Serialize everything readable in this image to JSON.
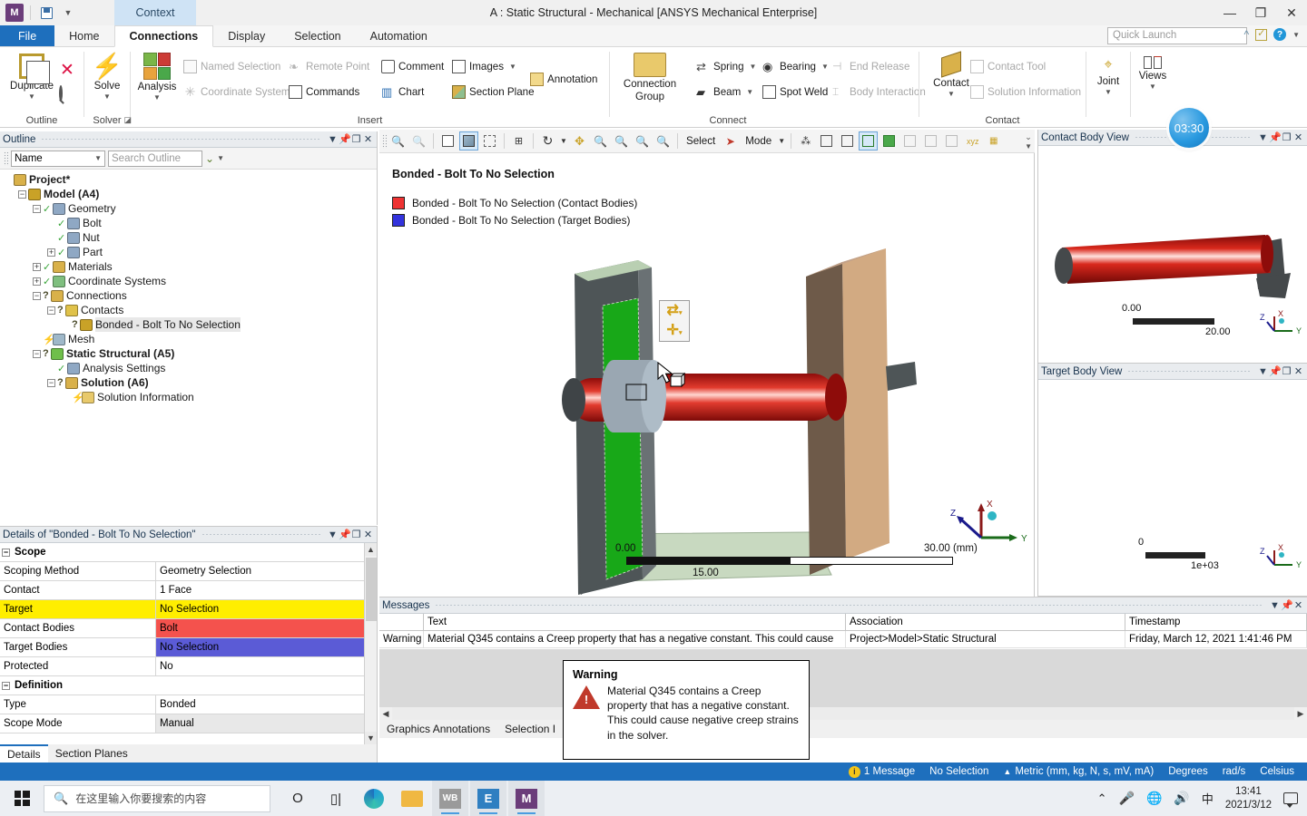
{
  "window": {
    "title": "A : Static Structural - Mechanical [ANSYS Mechanical Enterprise]",
    "app_icon_letter": "M",
    "context_tab": "Context",
    "minimize": "—",
    "restore": "❐",
    "close": "✕"
  },
  "ribbon": {
    "tabs": [
      {
        "label": "File",
        "kind": "file"
      },
      {
        "label": "Home",
        "kind": "normal"
      },
      {
        "label": "Connections",
        "kind": "active"
      },
      {
        "label": "Display",
        "kind": "normal"
      },
      {
        "label": "Selection",
        "kind": "normal"
      },
      {
        "label": "Automation",
        "kind": "normal"
      }
    ],
    "quick_launch_placeholder": "Quick Launch",
    "groups": [
      {
        "name": "Outline"
      },
      {
        "name": "Solver"
      },
      {
        "name": "Insert"
      },
      {
        "name": "Connect"
      },
      {
        "name": "Contact"
      }
    ],
    "outline_group": {
      "duplicate": "Duplicate",
      "delete_icon": "delete-x-icon",
      "find_icon": "magnifier-icon"
    },
    "solver_group": {
      "solve": "Solve"
    },
    "insert_group": {
      "analysis": "Analysis",
      "named_selection": "Named Selection",
      "coordinate_system": "Coordinate System",
      "remote_point": "Remote Point",
      "commands": "Commands",
      "comment": "Comment",
      "chart": "Chart",
      "images": "Images",
      "section_plane": "Section Plane",
      "annotation": "Annotation"
    },
    "connect_group": {
      "connection_group": "Connection\nGroup",
      "connection_group_l1": "Connection",
      "connection_group_l2": "Group",
      "spring": "Spring",
      "beam": "Beam",
      "bearing": "Bearing",
      "spot_weld": "Spot Weld",
      "end_release": "End Release",
      "body_interaction": "Body Interaction"
    },
    "contact_group": {
      "contact": "Contact",
      "contact_tool": "Contact Tool",
      "solution_information": "Solution Information",
      "joint": "Joint",
      "views": "Views"
    }
  },
  "outline": {
    "title": "Outline",
    "filter_selected": "Name",
    "search_placeholder": "Search Outline",
    "tree": [
      {
        "label": "Project*",
        "depth": 0,
        "exp": "none",
        "mark": "none",
        "icon": "project-icon",
        "bold": true,
        "selected": false
      },
      {
        "label": "Model (A4)",
        "depth": 1,
        "exp": "minus",
        "mark": "none",
        "icon": "model-icon",
        "bold": true,
        "selected": false
      },
      {
        "label": "Geometry",
        "depth": 2,
        "exp": "minus",
        "mark": "check",
        "icon": "geometry-icon",
        "bold": false,
        "selected": false
      },
      {
        "label": "Bolt",
        "depth": 3,
        "exp": "none",
        "mark": "check",
        "icon": "body-icon",
        "bold": false,
        "selected": false
      },
      {
        "label": "Nut",
        "depth": 3,
        "exp": "none",
        "mark": "check",
        "icon": "body-icon",
        "bold": false,
        "selected": false
      },
      {
        "label": "Part",
        "depth": 3,
        "exp": "plus",
        "mark": "check",
        "icon": "geometry-icon",
        "bold": false,
        "selected": false
      },
      {
        "label": "Materials",
        "depth": 2,
        "exp": "plus",
        "mark": "check",
        "icon": "materials-icon",
        "bold": false,
        "selected": false
      },
      {
        "label": "Coordinate Systems",
        "depth": 2,
        "exp": "plus",
        "mark": "check",
        "icon": "coordsys-icon",
        "bold": false,
        "selected": false
      },
      {
        "label": "Connections",
        "depth": 2,
        "exp": "minus",
        "mark": "question",
        "icon": "connections-icon",
        "bold": false,
        "selected": false
      },
      {
        "label": "Contacts",
        "depth": 3,
        "exp": "minus",
        "mark": "question",
        "icon": "contacts-icon",
        "bold": false,
        "selected": false
      },
      {
        "label": "Bonded - Bolt To No Selection",
        "depth": 4,
        "exp": "none",
        "mark": "question",
        "icon": "contact-region-icon",
        "bold": false,
        "selected": true
      },
      {
        "label": "Mesh",
        "depth": 2,
        "exp": "none",
        "mark": "light",
        "icon": "mesh-icon",
        "bold": false,
        "selected": false
      },
      {
        "label": "Static Structural (A5)",
        "depth": 2,
        "exp": "minus",
        "mark": "question",
        "icon": "static-structural-icon",
        "bold": true,
        "selected": false
      },
      {
        "label": "Analysis Settings",
        "depth": 3,
        "exp": "none",
        "mark": "check",
        "icon": "analysis-settings-icon",
        "bold": false,
        "selected": false
      },
      {
        "label": "Solution (A6)",
        "depth": 3,
        "exp": "minus",
        "mark": "question",
        "icon": "solution-icon",
        "bold": true,
        "selected": false
      },
      {
        "label": "Solution Information",
        "depth": 4,
        "exp": "none",
        "mark": "light",
        "icon": "solution-info-icon",
        "bold": false,
        "selected": false
      }
    ]
  },
  "details": {
    "title": "Details of \"Bonded - Bolt To No Selection\"",
    "rows": [
      {
        "type": "category",
        "key": "Scope",
        "value": "",
        "highlight": "none"
      },
      {
        "type": "field",
        "key": "Scoping Method",
        "value": "Geometry Selection",
        "highlight": "none"
      },
      {
        "type": "field",
        "key": "Contact",
        "value": "1 Face",
        "highlight": "none"
      },
      {
        "type": "field",
        "key": "Target",
        "value": "No Selection",
        "highlight": "yellow"
      },
      {
        "type": "field",
        "key": "Contact Bodies",
        "value": "Bolt",
        "highlight": "red"
      },
      {
        "type": "field",
        "key": "Target Bodies",
        "value": "No Selection",
        "highlight": "blue"
      },
      {
        "type": "field",
        "key": "Protected",
        "value": "No",
        "highlight": "none"
      },
      {
        "type": "category",
        "key": "Definition",
        "value": "",
        "highlight": "none"
      },
      {
        "type": "field",
        "key": "Type",
        "value": "Bonded",
        "highlight": "none"
      },
      {
        "type": "field",
        "key": "Scope Mode",
        "value": "Manual",
        "highlight": "gray"
      }
    ],
    "tabs": [
      {
        "label": "Details",
        "active": true
      },
      {
        "label": "Section Planes",
        "active": false
      }
    ],
    "highlight_colors": {
      "yellow": "#ffee00",
      "red": "#f4524d",
      "blue": "#5b5bd6",
      "gray": "#e8e8e8"
    }
  },
  "graphics_toolbar": {
    "select_label": "Select",
    "mode_label": "Mode",
    "buttons": [
      "zoom-out-icon",
      "zoom-in-icon",
      "wireframe-cube-icon",
      "shaded-cube-icon",
      "edges-cube-icon",
      "box-select-icon",
      "rotate-icon",
      "pan-icon",
      "zoom-minus-icon",
      "zoom-plus-icon",
      "box-zoom-icon",
      "zoom-to-fit-icon",
      "select-arrow-icon",
      "extend-selection-icon",
      "vertex-select-icon",
      "edge-select-icon",
      "face-select-icon",
      "body-select-icon",
      "single-select-icon",
      "box-volume-select-icon",
      "box-surface-select-icon",
      "xyz-probe-icon",
      "label-icon"
    ]
  },
  "viewport": {
    "title": "Bonded - Bolt To No Selection",
    "legend": [
      {
        "color": "#ee3333",
        "label": "Bonded - Bolt To No Selection (Contact Bodies)"
      },
      {
        "color": "#3333dd",
        "label": "Bonded - Bolt To No Selection (Target Bodies)"
      }
    ],
    "scale": {
      "min": "0.00",
      "mid": "15.00",
      "max": "30.00 (mm)"
    },
    "triad": {
      "x": "X",
      "y": "Y",
      "z": "Z"
    }
  },
  "contact_body_view": {
    "title": "Contact Body View",
    "scale": {
      "min": "0.00",
      "max": "20.00"
    },
    "triad": {
      "x": "X",
      "y": "Y",
      "z": "Z"
    }
  },
  "target_body_view": {
    "title": "Target Body View",
    "scale": {
      "min": "0",
      "max": "1e+03"
    },
    "triad": {
      "x": "X",
      "y": "Y",
      "z": "Z"
    }
  },
  "messages": {
    "title": "Messages",
    "columns": [
      "",
      "Text",
      "Association",
      "Timestamp"
    ],
    "rows": [
      {
        "type": "Warning",
        "text": "Material Q345 contains a Creep property that has a negative constant. This could cause",
        "association": "Project>Model>Static Structural",
        "timestamp": "Friday, March 12, 2021 1:41:46 PM"
      }
    ],
    "tabs": [
      {
        "label": "Graphics Annotations",
        "active": false
      },
      {
        "label": "Selection I",
        "active": false
      }
    ]
  },
  "warning_tooltip": {
    "title": "Warning",
    "text": "Material Q345 contains a Creep property that has a negative constant. This could cause negative creep strains in the solver."
  },
  "statusbar": {
    "message_count": "1 Message",
    "selection": "No Selection",
    "units": "Metric (mm, kg, N, s, mV, mA)",
    "angle": "Degrees",
    "rotation": "rad/s",
    "temperature": "Celsius"
  },
  "timer": {
    "value": "03:30"
  },
  "taskbar": {
    "search_placeholder": "在这里输入你要搜索的内容",
    "apps": [
      {
        "name": "cortana-icon",
        "letter": "O",
        "active": false
      },
      {
        "name": "task-view-icon",
        "letter": "⌸",
        "active": false
      },
      {
        "name": "edge-icon",
        "letter": "e",
        "active": false
      },
      {
        "name": "file-explorer-icon",
        "letter": "🗀",
        "active": false
      },
      {
        "name": "workbench-icon",
        "letter": "WB",
        "active": true
      },
      {
        "name": "engineering-data-icon",
        "letter": "E",
        "active": true
      },
      {
        "name": "mechanical-icon",
        "letter": "M",
        "active": true
      }
    ],
    "tray": {
      "chevron": "⌃",
      "mic": "mic-icon",
      "network": "network-icon",
      "volume": "volume-icon",
      "ime": "中",
      "time": "13:41",
      "date": "2021/3/12"
    }
  }
}
